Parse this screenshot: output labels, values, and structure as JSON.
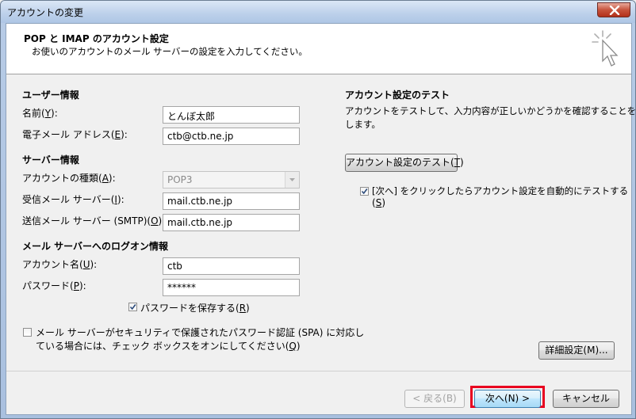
{
  "window": {
    "title": "アカウントの変更"
  },
  "header": {
    "title": "POP と IMAP のアカウント設定",
    "subtitle": "お使いのアカウントのメール サーバーの設定を入力してください。"
  },
  "user_info": {
    "section": "ユーザー情報",
    "name_label": "名前(",
    "name_key": "Y",
    "name_value": "とんぼ太郎",
    "email_label": "電子メール アドレス(",
    "email_key": "E",
    "email_value": "ctb@ctb.ne.jp"
  },
  "server_info": {
    "section": "サーバー情報",
    "account_type_label": "アカウントの種類(",
    "account_type_key": "A",
    "account_type_value": "POP3",
    "incoming_label": "受信メール サーバー(",
    "incoming_key": "I",
    "incoming_value": "mail.ctb.ne.jp",
    "outgoing_label": "送信メール サーバー (SMTP)(",
    "outgoing_key": "O",
    "outgoing_value": "mail.ctb.ne.jp"
  },
  "logon_info": {
    "section": "メール サーバーへのログオン情報",
    "account_label": "アカウント名(",
    "account_key": "U",
    "account_value": "ctb",
    "password_label": "パスワード(",
    "password_key": "P",
    "password_value": "******",
    "remember_label": "パスワードを保存する(",
    "remember_key": "R",
    "remember_checked": true
  },
  "spa": {
    "line1": "メール サーバーがセキュリティで保護されたパスワード認証 (SPA) に対応し",
    "line2": "ている場合には、チェック ボックスをオンにしてください(",
    "key": "Q",
    "checked": false
  },
  "test": {
    "section": "アカウント設定のテスト",
    "description_line1": "アカウントをテストして、入力内容が正しいかどうかを確認することをお勧め",
    "description_line2": "します。",
    "button_label": "アカウント設定のテスト(",
    "button_key": "T",
    "auto_label": "[次へ] をクリックしたらアカウント設定を自動的にテストする",
    "auto_key": "S",
    "auto_checked": true
  },
  "buttons": {
    "advanced": "詳細設定(M)...",
    "back": "< 戻る(B)",
    "next": "次へ(N) >",
    "cancel": "キャンセル"
  },
  "colors": {
    "highlight": "#e8001f",
    "accent": "#3c7fb1"
  }
}
